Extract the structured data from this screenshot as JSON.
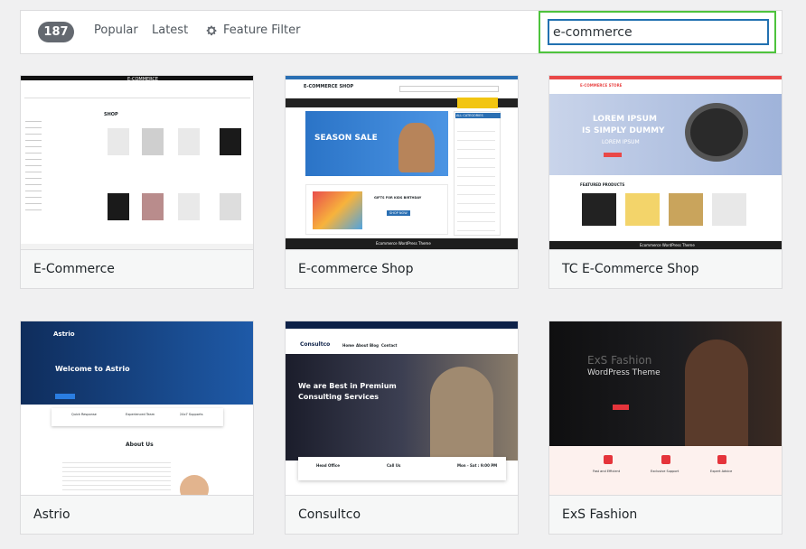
{
  "filter": {
    "count": "187",
    "tabs": [
      "Popular",
      "Latest"
    ],
    "feature_filter": "Feature Filter",
    "search_value": "e-commerce"
  },
  "themes": [
    {
      "name": "E-Commerce",
      "thumb": {
        "logo": "E-COMMERCE",
        "heading": "SHOP"
      }
    },
    {
      "name": "E-commerce Shop",
      "thumb": {
        "logo": "E-COMMERCE SHOP",
        "banner": "SEASON SALE",
        "side_title": "ALL CATEGORIES",
        "promo": "GIFTS FOR KIDS BIRTHDAY",
        "button": "SHOP NOW",
        "footer": "Ecommerce WordPress Theme"
      }
    },
    {
      "name": "TC E-Commerce Shop",
      "thumb": {
        "logo": "E-COMMERCE STORE",
        "hero1": "LOREM IPSUM",
        "hero2": "IS SIMPLY DUMMY",
        "hero3": "LOREM IPSUM",
        "section": "FEATURED PRODUCTS",
        "footer": "Ecommerce WordPress Theme"
      }
    },
    {
      "name": "Astrio",
      "thumb": {
        "logo": "Astrio",
        "hero": "Welcome to Astrio",
        "about": "About Us",
        "features": [
          "Quick Response",
          "Experienced Team",
          "24x7 Supports"
        ]
      }
    },
    {
      "name": "Consultco",
      "thumb": {
        "logo": "Consultco",
        "hero": "We are Best in Premium Consulting Services",
        "info": [
          "Head Office",
          "Call Us",
          "Mon - Sat : 9:00 PM"
        ],
        "nav": [
          "Home",
          "About",
          "Blog",
          "Contact"
        ]
      }
    },
    {
      "name": "ExS Fashion",
      "thumb": {
        "title": "ExS Fashion",
        "subtitle": "WordPress Theme",
        "features": [
          "Fast and Efficient",
          "Exclusive Support",
          "Expert Advice"
        ]
      }
    }
  ],
  "colors": {
    "accent": "#2271b1",
    "highlight": "#4ec33d",
    "badge": "#646970"
  }
}
